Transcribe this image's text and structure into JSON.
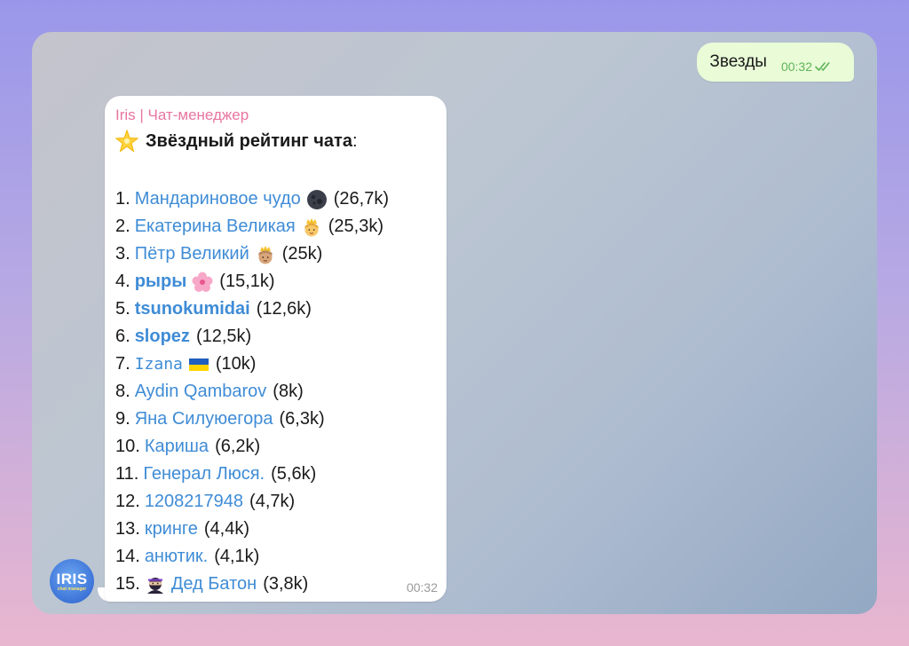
{
  "outgoing": {
    "text": "Звезды",
    "time": "00:32"
  },
  "incoming": {
    "sender": "Iris | Чат-менеджер",
    "heading_text": "Звёздный рейтинг чата",
    "heading_suffix": ":",
    "time": "00:32",
    "items": [
      {
        "rank": "1.",
        "name": "Мандариновое чудо",
        "score": "(26,7k)",
        "emoji": "moon-emoji-icon"
      },
      {
        "rank": "2.",
        "name": "Екатерина Великая",
        "score": "(25,3k)",
        "emoji": "princess-emoji-icon"
      },
      {
        "rank": "3.",
        "name": "Пётр Великий",
        "score": "(25k)",
        "emoji": "prince-emoji-icon"
      },
      {
        "rank": "4.",
        "name": "рыры",
        "score": "(15,1k)",
        "emoji": "cherry-blossom-emoji-icon"
      },
      {
        "rank": "5.",
        "name": "tsunokumidai",
        "score": "(12,6k)"
      },
      {
        "rank": "6.",
        "name": "slopez",
        "score": "(12,5k)"
      },
      {
        "rank": "7.",
        "name": "Izana⁢⁢",
        "score": "(10k)",
        "emoji": "ukraine-flag-emoji-icon"
      },
      {
        "rank": "8.",
        "name": "Aydin Qambarov",
        "score": "(8k)"
      },
      {
        "rank": "9.",
        "name": "Яна Силуюегора",
        "score": "(6,3k)"
      },
      {
        "rank": "10.",
        "name": "Кариша",
        "score": "(6,2k)"
      },
      {
        "rank": "11.",
        "name": "Генерал Люся.",
        "score": "(5,6k)"
      },
      {
        "rank": "12.",
        "name": "1208217948",
        "score": "(4,7k)"
      },
      {
        "rank": "13.",
        "name": "кринге",
        "score": "(4,4k)"
      },
      {
        "rank": "14.",
        "name": "анютик.",
        "score": "(4,1k)"
      },
      {
        "rank": "15.",
        "name": "Дед Батон",
        "score": "(3,8k)",
        "emoji_before": "ninja-emoji-icon"
      }
    ]
  },
  "avatar": {
    "big": "IRIS",
    "small": "chat manager"
  },
  "colors": {
    "link": "#3f8cd6",
    "sender": "#e8759f",
    "outgoing_bg": "#e9fbd7",
    "check": "#5fb45a"
  }
}
